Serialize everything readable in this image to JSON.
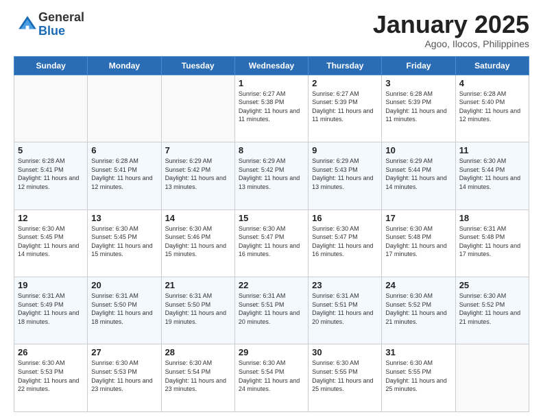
{
  "logo": {
    "general": "General",
    "blue": "Blue"
  },
  "header": {
    "month": "January 2025",
    "location": "Agoo, Ilocos, Philippines"
  },
  "days_of_week": [
    "Sunday",
    "Monday",
    "Tuesday",
    "Wednesday",
    "Thursday",
    "Friday",
    "Saturday"
  ],
  "weeks": [
    [
      {
        "day": "",
        "sunrise": "",
        "sunset": "",
        "daylight": "",
        "empty": true
      },
      {
        "day": "",
        "sunrise": "",
        "sunset": "",
        "daylight": "",
        "empty": true
      },
      {
        "day": "",
        "sunrise": "",
        "sunset": "",
        "daylight": "",
        "empty": true
      },
      {
        "day": "1",
        "sunrise": "Sunrise: 6:27 AM",
        "sunset": "Sunset: 5:38 PM",
        "daylight": "Daylight: 11 hours and 11 minutes.",
        "empty": false
      },
      {
        "day": "2",
        "sunrise": "Sunrise: 6:27 AM",
        "sunset": "Sunset: 5:39 PM",
        "daylight": "Daylight: 11 hours and 11 minutes.",
        "empty": false
      },
      {
        "day": "3",
        "sunrise": "Sunrise: 6:28 AM",
        "sunset": "Sunset: 5:39 PM",
        "daylight": "Daylight: 11 hours and 11 minutes.",
        "empty": false
      },
      {
        "day": "4",
        "sunrise": "Sunrise: 6:28 AM",
        "sunset": "Sunset: 5:40 PM",
        "daylight": "Daylight: 11 hours and 12 minutes.",
        "empty": false
      }
    ],
    [
      {
        "day": "5",
        "sunrise": "Sunrise: 6:28 AM",
        "sunset": "Sunset: 5:41 PM",
        "daylight": "Daylight: 11 hours and 12 minutes.",
        "empty": false
      },
      {
        "day": "6",
        "sunrise": "Sunrise: 6:28 AM",
        "sunset": "Sunset: 5:41 PM",
        "daylight": "Daylight: 11 hours and 12 minutes.",
        "empty": false
      },
      {
        "day": "7",
        "sunrise": "Sunrise: 6:29 AM",
        "sunset": "Sunset: 5:42 PM",
        "daylight": "Daylight: 11 hours and 13 minutes.",
        "empty": false
      },
      {
        "day": "8",
        "sunrise": "Sunrise: 6:29 AM",
        "sunset": "Sunset: 5:42 PM",
        "daylight": "Daylight: 11 hours and 13 minutes.",
        "empty": false
      },
      {
        "day": "9",
        "sunrise": "Sunrise: 6:29 AM",
        "sunset": "Sunset: 5:43 PM",
        "daylight": "Daylight: 11 hours and 13 minutes.",
        "empty": false
      },
      {
        "day": "10",
        "sunrise": "Sunrise: 6:29 AM",
        "sunset": "Sunset: 5:44 PM",
        "daylight": "Daylight: 11 hours and 14 minutes.",
        "empty": false
      },
      {
        "day": "11",
        "sunrise": "Sunrise: 6:30 AM",
        "sunset": "Sunset: 5:44 PM",
        "daylight": "Daylight: 11 hours and 14 minutes.",
        "empty": false
      }
    ],
    [
      {
        "day": "12",
        "sunrise": "Sunrise: 6:30 AM",
        "sunset": "Sunset: 5:45 PM",
        "daylight": "Daylight: 11 hours and 14 minutes.",
        "empty": false
      },
      {
        "day": "13",
        "sunrise": "Sunrise: 6:30 AM",
        "sunset": "Sunset: 5:45 PM",
        "daylight": "Daylight: 11 hours and 15 minutes.",
        "empty": false
      },
      {
        "day": "14",
        "sunrise": "Sunrise: 6:30 AM",
        "sunset": "Sunset: 5:46 PM",
        "daylight": "Daylight: 11 hours and 15 minutes.",
        "empty": false
      },
      {
        "day": "15",
        "sunrise": "Sunrise: 6:30 AM",
        "sunset": "Sunset: 5:47 PM",
        "daylight": "Daylight: 11 hours and 16 minutes.",
        "empty": false
      },
      {
        "day": "16",
        "sunrise": "Sunrise: 6:30 AM",
        "sunset": "Sunset: 5:47 PM",
        "daylight": "Daylight: 11 hours and 16 minutes.",
        "empty": false
      },
      {
        "day": "17",
        "sunrise": "Sunrise: 6:30 AM",
        "sunset": "Sunset: 5:48 PM",
        "daylight": "Daylight: 11 hours and 17 minutes.",
        "empty": false
      },
      {
        "day": "18",
        "sunrise": "Sunrise: 6:31 AM",
        "sunset": "Sunset: 5:48 PM",
        "daylight": "Daylight: 11 hours and 17 minutes.",
        "empty": false
      }
    ],
    [
      {
        "day": "19",
        "sunrise": "Sunrise: 6:31 AM",
        "sunset": "Sunset: 5:49 PM",
        "daylight": "Daylight: 11 hours and 18 minutes.",
        "empty": false
      },
      {
        "day": "20",
        "sunrise": "Sunrise: 6:31 AM",
        "sunset": "Sunset: 5:50 PM",
        "daylight": "Daylight: 11 hours and 18 minutes.",
        "empty": false
      },
      {
        "day": "21",
        "sunrise": "Sunrise: 6:31 AM",
        "sunset": "Sunset: 5:50 PM",
        "daylight": "Daylight: 11 hours and 19 minutes.",
        "empty": false
      },
      {
        "day": "22",
        "sunrise": "Sunrise: 6:31 AM",
        "sunset": "Sunset: 5:51 PM",
        "daylight": "Daylight: 11 hours and 20 minutes.",
        "empty": false
      },
      {
        "day": "23",
        "sunrise": "Sunrise: 6:31 AM",
        "sunset": "Sunset: 5:51 PM",
        "daylight": "Daylight: 11 hours and 20 minutes.",
        "empty": false
      },
      {
        "day": "24",
        "sunrise": "Sunrise: 6:30 AM",
        "sunset": "Sunset: 5:52 PM",
        "daylight": "Daylight: 11 hours and 21 minutes.",
        "empty": false
      },
      {
        "day": "25",
        "sunrise": "Sunrise: 6:30 AM",
        "sunset": "Sunset: 5:52 PM",
        "daylight": "Daylight: 11 hours and 21 minutes.",
        "empty": false
      }
    ],
    [
      {
        "day": "26",
        "sunrise": "Sunrise: 6:30 AM",
        "sunset": "Sunset: 5:53 PM",
        "daylight": "Daylight: 11 hours and 22 minutes.",
        "empty": false
      },
      {
        "day": "27",
        "sunrise": "Sunrise: 6:30 AM",
        "sunset": "Sunset: 5:53 PM",
        "daylight": "Daylight: 11 hours and 23 minutes.",
        "empty": false
      },
      {
        "day": "28",
        "sunrise": "Sunrise: 6:30 AM",
        "sunset": "Sunset: 5:54 PM",
        "daylight": "Daylight: 11 hours and 23 minutes.",
        "empty": false
      },
      {
        "day": "29",
        "sunrise": "Sunrise: 6:30 AM",
        "sunset": "Sunset: 5:54 PM",
        "daylight": "Daylight: 11 hours and 24 minutes.",
        "empty": false
      },
      {
        "day": "30",
        "sunrise": "Sunrise: 6:30 AM",
        "sunset": "Sunset: 5:55 PM",
        "daylight": "Daylight: 11 hours and 25 minutes.",
        "empty": false
      },
      {
        "day": "31",
        "sunrise": "Sunrise: 6:30 AM",
        "sunset": "Sunset: 5:55 PM",
        "daylight": "Daylight: 11 hours and 25 minutes.",
        "empty": false
      },
      {
        "day": "",
        "sunrise": "",
        "sunset": "",
        "daylight": "",
        "empty": true
      }
    ]
  ]
}
